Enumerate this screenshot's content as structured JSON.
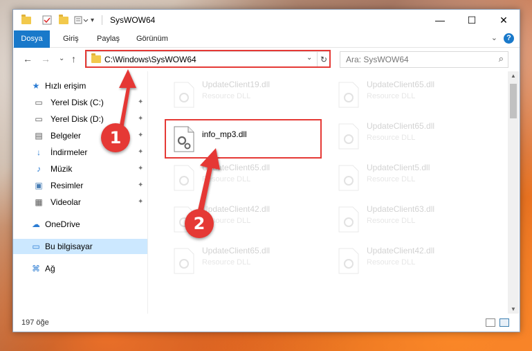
{
  "window": {
    "title": "SysWOW64",
    "controls": {
      "minimize": "—",
      "maximize": "☐",
      "close": "✕"
    }
  },
  "ribbon": {
    "tabs": [
      "Dosya",
      "Giriş",
      "Paylaş",
      "Görünüm"
    ],
    "help": "?",
    "collapse": "⌄"
  },
  "nav": {
    "back": "←",
    "forward": "→",
    "recent": "⌄",
    "up": "↑"
  },
  "address": {
    "path": "C:\\Windows\\SysWOW64",
    "dropdown": "⌄",
    "refresh": "↻"
  },
  "search": {
    "placeholder": "Ara: SysWOW64",
    "icon": "⌕"
  },
  "sidebar": {
    "items": [
      {
        "label": "Hızlı erişim",
        "icon": "★",
        "pinned": false
      },
      {
        "label": "Yerel Disk (C:)",
        "icon": "▭",
        "pinned": true
      },
      {
        "label": "Yerel Disk (D:)",
        "icon": "▭",
        "pinned": true
      },
      {
        "label": "Belgeler",
        "icon": "▤",
        "pinned": true
      },
      {
        "label": "İndirmeler",
        "icon": "↓",
        "pinned": true
      },
      {
        "label": "Müzik",
        "icon": "♪",
        "pinned": true
      },
      {
        "label": "Resimler",
        "icon": "▣",
        "pinned": true
      },
      {
        "label": "Videolar",
        "icon": "▦",
        "pinned": true
      },
      {
        "label": "OneDrive",
        "icon": "☁",
        "pinned": false
      },
      {
        "label": "Bu bilgisayar",
        "icon": "▭",
        "pinned": false
      },
      {
        "label": "Ağ",
        "icon": "⌘",
        "pinned": false
      }
    ],
    "pin_glyph": "📌"
  },
  "files": [
    {
      "name": "UpdateClient19.dll",
      "type": "Resource DLL"
    },
    {
      "name": "UpdateClient65.dll",
      "type": "Resource DLL"
    },
    {
      "name": "info_mp3.dll",
      "type": ""
    },
    {
      "name": "UpdateClient65.dll",
      "type": "Resource DLL"
    },
    {
      "name": "UpdateClient65.dll",
      "type": "Resource DLL"
    },
    {
      "name": "UpdateClient5.dll",
      "type": "Resource DLL"
    },
    {
      "name": "UpdateClient42.dll",
      "type": "Resource DLL"
    },
    {
      "name": "UpdateClient63.dll",
      "type": "Resource DLL"
    },
    {
      "name": "UpdateClient65.dll",
      "type": "Resource DLL"
    },
    {
      "name": "UpdateClient42.dll",
      "type": "Resource DLL"
    }
  ],
  "status": {
    "count": "197 öğe"
  },
  "steps": [
    "1",
    "2"
  ],
  "colors": {
    "accent": "#1979ca",
    "highlight": "#e53935",
    "selected": "#cce8ff"
  }
}
